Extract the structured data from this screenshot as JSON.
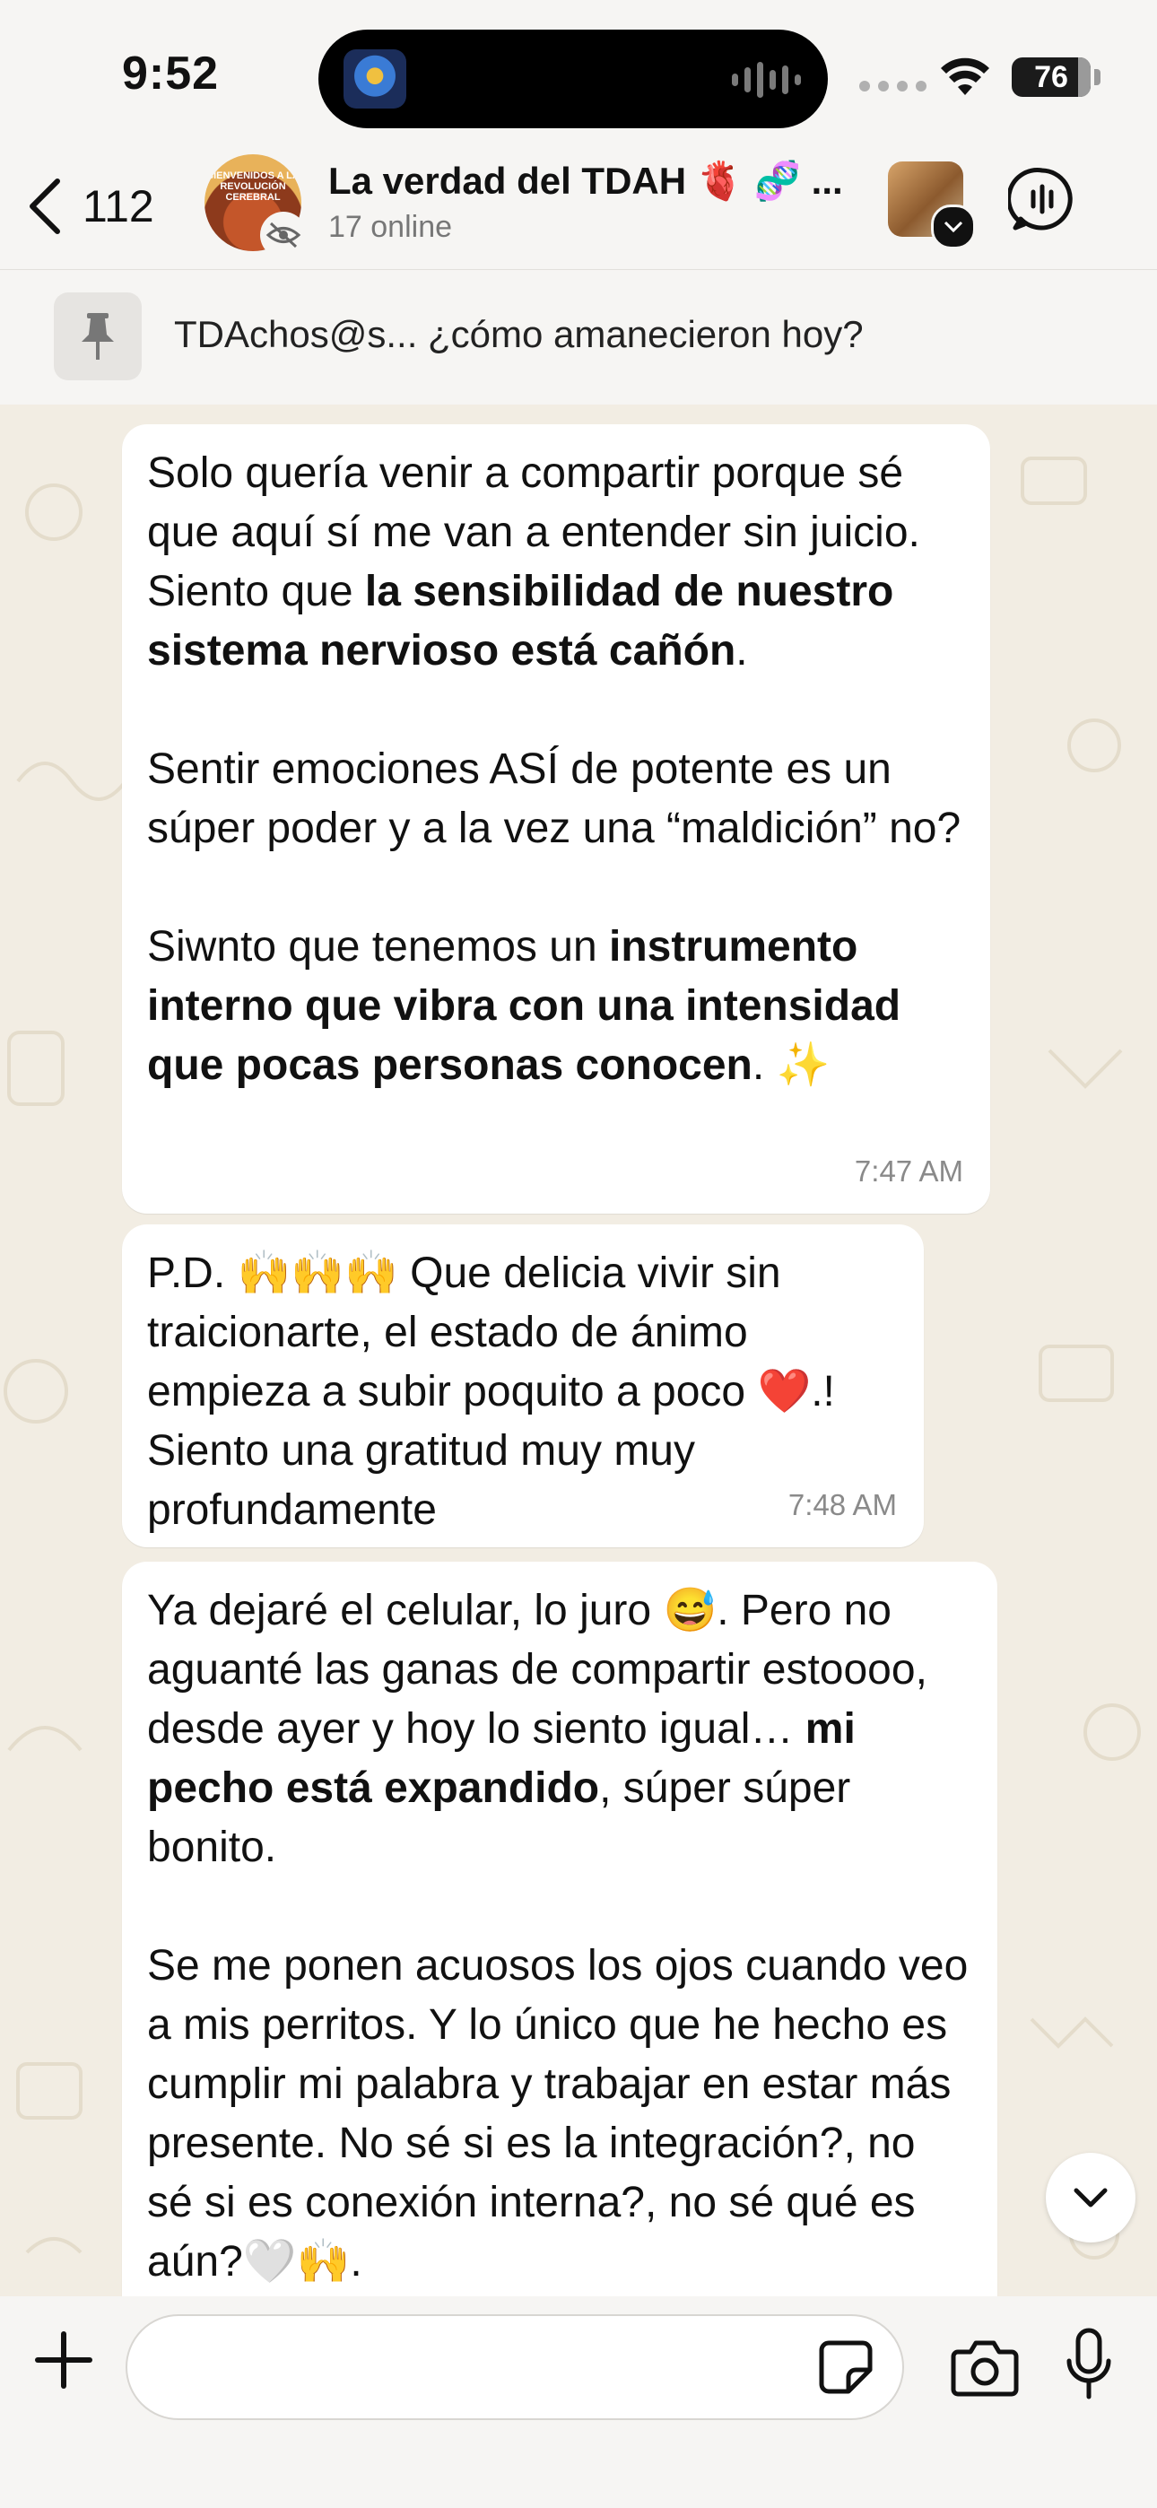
{
  "status_bar": {
    "time": "9:52",
    "battery": "76"
  },
  "header": {
    "back_count": "112",
    "avatar_text": "BIENVENIDOS A LA REVOLUCIÓN CEREBRAL",
    "group_name": "La verdad del TDAH 🫀 🧬 ...",
    "status": "17 online"
  },
  "pinned": {
    "text": "TDAchos@s... ¿cómo amanecieron hoy?"
  },
  "messages": [
    {
      "time": "7:47 AM",
      "p1a": "Solo quería venir a compartir porque sé que aquí sí me van a entender sin juicio. Siento que ",
      "p1b": "la sensibilidad de nuestro sistema nervioso está cañón",
      "p1c": ".",
      "p2": "Sentir emociones ASÍ de potente es un súper poder y a la vez una “maldición” no?",
      "p3a": "Siwnto que tenemos un ",
      "p3b": "instrumento interno que vibra con una intensidad que pocas personas conocen",
      "p3c": ". ✨"
    },
    {
      "time": "7:48 AM",
      "p1a": "P.D. 🙌🙌🙌 Que delicia vivir sin traicionarte, el estado de ánimo empieza a subir poquito a poco ❤️.! Siento una gratitud muy muy profundamente"
    },
    {
      "p1a": "Ya dejaré el celular, lo juro 😅. Pero no aguanté las ganas de compartir estoooo, desde ayer y hoy lo siento igual… ",
      "p1b": "mi pecho está expandido",
      "p1c": ", súper súper bonito.",
      "p2": "Se me ponen acuosos los ojos cuando veo a mis perritos. Y lo único que he hecho es cumplir mi palabra y trabajar en estar más presente. No sé si es la integración?, no sé si es conexión interna?, no sé qué es  aún?🤍🙌."
    }
  ],
  "composer": {
    "value": "",
    "placeholder": ""
  }
}
